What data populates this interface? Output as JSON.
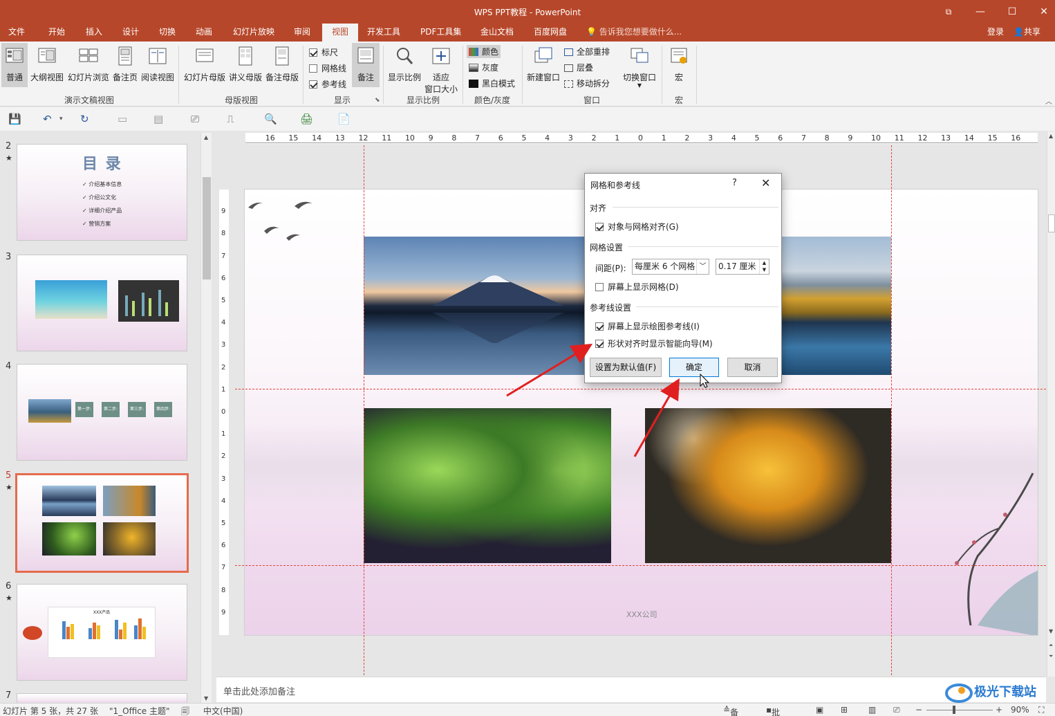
{
  "window": {
    "title": "WPS PPT教程 - PowerPoint",
    "min_label": "—",
    "max_label": "☐",
    "close_label": "✕",
    "restore_label": "⧉"
  },
  "menu": {
    "tabs": [
      "文件",
      "开始",
      "插入",
      "设计",
      "切换",
      "动画",
      "幻灯片放映",
      "审阅",
      "视图",
      "开发工具",
      "PDF工具集",
      "金山文档",
      "百度网盘"
    ],
    "active": "视图",
    "tell_me": "告诉我您想要做什么...",
    "login": "登录",
    "share": "共享"
  },
  "ribbon": {
    "presentation_views": {
      "label": "演示文稿视图",
      "buttons": [
        "普通",
        "大纲视图",
        "幻灯片浏览",
        "备注页",
        "阅读视图"
      ]
    },
    "master_views": {
      "label": "母版视图",
      "buttons": [
        "幻灯片母版",
        "讲义母版",
        "备注母版"
      ]
    },
    "show": {
      "label": "显示",
      "items": [
        {
          "text": "标尺",
          "checked": true
        },
        {
          "text": "网格线",
          "checked": false
        },
        {
          "text": "参考线",
          "checked": true
        }
      ],
      "notes_button": "备注"
    },
    "zoom": {
      "label": "显示比例",
      "zoom_button": "显示比例",
      "fit_button_1": "适应",
      "fit_button_2": "窗口大小"
    },
    "color": {
      "label": "颜色/灰度",
      "items": [
        "颜色",
        "灰度",
        "黑白模式"
      ]
    },
    "window": {
      "label": "窗口",
      "new_window": "新建窗口",
      "arrange_all": "全部重排",
      "cascade": "层叠",
      "move_split": "移动拆分",
      "switch_window": "切换窗口"
    },
    "macros": {
      "label": "宏",
      "button": "宏"
    }
  },
  "thumbnails": [
    {
      "num": "2",
      "star": "★",
      "title": "目 录",
      "items": [
        "介绍基本信息",
        "介绍公文化",
        "详细介绍产品",
        "营销方案"
      ]
    },
    {
      "num": "3",
      "star": "★"
    },
    {
      "num": "4",
      "star": "★",
      "steps": [
        "第一步:",
        "第二步:",
        "第三步:",
        "第四步:"
      ]
    },
    {
      "num": "5",
      "star": "★",
      "selected": true
    },
    {
      "num": "6",
      "star": "★",
      "chart_title": "XXX产品"
    },
    {
      "num": "7"
    }
  ],
  "ruler": {
    "h_ticks": [
      "16",
      "15",
      "14",
      "13",
      "12",
      "11",
      "10",
      "9",
      "8",
      "7",
      "6",
      "5",
      "4",
      "3",
      "2",
      "1",
      "0",
      "1",
      "2",
      "3",
      "4",
      "5",
      "6",
      "7",
      "8",
      "9",
      "10",
      "11",
      "12",
      "13",
      "14",
      "15",
      "16"
    ],
    "v_ticks": [
      "9",
      "8",
      "7",
      "6",
      "5",
      "4",
      "3",
      "2",
      "1",
      "0",
      "1",
      "2",
      "3",
      "4",
      "5",
      "6",
      "7",
      "8",
      "9"
    ]
  },
  "slide": {
    "footer": "XXX公司"
  },
  "notes_placeholder": "单击此处添加备注",
  "status": {
    "slide_info": "幻灯片 第 5 张，共 27 张",
    "theme": "\"1_Office 主题\"",
    "language": "中文(中国)",
    "notes": "备注",
    "comments": "批注",
    "zoom": "90%"
  },
  "dialog": {
    "title": "网格和参考线",
    "help": "?",
    "close": "✕",
    "align_section": "对齐",
    "snap_to_grid": {
      "text": "对象与网格对齐(G)",
      "checked": true
    },
    "grid_section": "网格设置",
    "spacing_label": "间距(P):",
    "spacing_select": "每厘米 6 个网格",
    "spacing_value": "0.17 厘米",
    "show_grid": {
      "text": "屏幕上显示网格(D)",
      "checked": false
    },
    "guides_section": "参考线设置",
    "show_guides": {
      "text": "屏幕上显示绘图参考线(I)",
      "checked": true
    },
    "smart_guides": {
      "text": "形状对齐时显示智能向导(M)",
      "checked": true
    },
    "set_default": "设置为默认值(F)",
    "ok": "确定",
    "cancel": "取消"
  },
  "watermark": "极光下载站",
  "colors": {
    "brand": "#b7472a",
    "accent_selected": "#e46b4c",
    "guide": "#e0443a",
    "arrow": "#e02020"
  }
}
